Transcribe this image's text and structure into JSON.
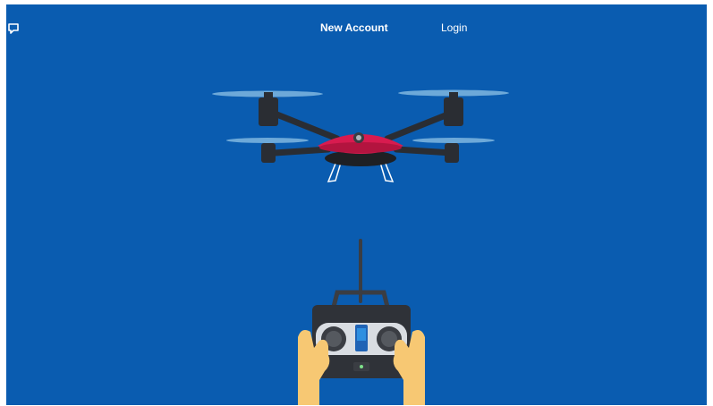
{
  "nav": {
    "new_account_label": "New Account",
    "login_label": "Login",
    "chat_icon": "chat-bubble-icon"
  },
  "colors": {
    "background": "#0a5cb0",
    "drone_body": "#d81b4f",
    "drone_arms": "#2a2d33",
    "propeller": "#7fb6e0",
    "skin": "#f7c873",
    "controller_frame": "#3a3d43",
    "controller_face": "#d9dde2",
    "controller_slider": "#2e8fe0"
  }
}
